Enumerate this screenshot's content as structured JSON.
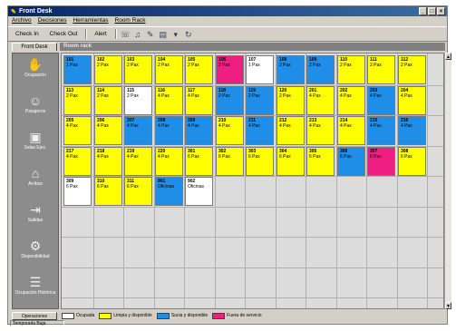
{
  "window": {
    "title": "Front Desk"
  },
  "menu": [
    "Archivo",
    "Decisiones",
    "Herramientas",
    "Room Rack"
  ],
  "toolbar": {
    "check_in": "Check In",
    "check_out": "Check Out",
    "alert": "Alert"
  },
  "tab": {
    "label": "Front Desk",
    "header": "Room rack"
  },
  "sidebar": [
    {
      "label": "Ocupación",
      "icon": "hand-key-icon"
    },
    {
      "label": "Pasajeros",
      "icon": "guests-icon"
    },
    {
      "label": "Salas Ejec.",
      "icon": "floppy-disk-icon"
    },
    {
      "label": "Arribos",
      "icon": "arrival-house-icon"
    },
    {
      "label": "Salidas",
      "icon": "departure-door-icon"
    },
    {
      "label": "Disponibilidad",
      "icon": "key-ring-icon"
    },
    {
      "label": "Ocupación Histórica",
      "icon": "history-report-icon"
    }
  ],
  "colors": {
    "yellow": "#ffff00",
    "blue": "#1e8ee8",
    "magenta": "#ee1f80",
    "white": "#ffffff"
  },
  "rooms": [
    [
      {
        "n": "101",
        "s": "1 Pax",
        "c": "blue"
      },
      {
        "n": "102",
        "s": "2 Pax",
        "c": "yellow"
      },
      {
        "n": "103",
        "s": "2 Pax",
        "c": "yellow"
      },
      {
        "n": "104",
        "s": "2 Pax",
        "c": "yellow"
      },
      {
        "n": "105",
        "s": "2 Pax",
        "c": "yellow"
      },
      {
        "n": "106",
        "s": "2 Pax",
        "c": "magenta"
      },
      {
        "n": "107",
        "s": "1 Pax",
        "c": "white"
      },
      {
        "n": "108",
        "s": "2 Pax",
        "c": "blue"
      },
      {
        "n": "109",
        "s": "2 Pax",
        "c": "blue"
      },
      {
        "n": "110",
        "s": "2 Pax",
        "c": "yellow"
      },
      {
        "n": "111",
        "s": "2 Pax",
        "c": "yellow"
      },
      {
        "n": "112",
        "s": "2 Pax",
        "c": "yellow"
      }
    ],
    [
      {
        "n": "113",
        "s": "2 Pax",
        "c": "yellow"
      },
      {
        "n": "114",
        "s": "2 Pax",
        "c": "yellow"
      },
      {
        "n": "115",
        "s": "2 Pax",
        "c": "white"
      },
      {
        "n": "116",
        "s": "4 Pax",
        "c": "yellow"
      },
      {
        "n": "117",
        "s": "4 Pax",
        "c": "yellow"
      },
      {
        "n": "118",
        "s": "2 Pax",
        "c": "blue"
      },
      {
        "n": "119",
        "s": "2 Pax",
        "c": "blue"
      },
      {
        "n": "120",
        "s": "2 Pax",
        "c": "yellow"
      },
      {
        "n": "201",
        "s": "4 Pax",
        "c": "yellow"
      },
      {
        "n": "202",
        "s": "4 Pax",
        "c": "yellow"
      },
      {
        "n": "203",
        "s": "4 Pax",
        "c": "blue"
      },
      {
        "n": "204",
        "s": "4 Pax",
        "c": "yellow"
      }
    ],
    [
      {
        "n": "205",
        "s": "4 Pax",
        "c": "yellow"
      },
      {
        "n": "206",
        "s": "4 Pax",
        "c": "yellow"
      },
      {
        "n": "207",
        "s": "4 Pax",
        "c": "blue"
      },
      {
        "n": "208",
        "s": "4 Pax",
        "c": "blue"
      },
      {
        "n": "209",
        "s": "4 Pax",
        "c": "blue"
      },
      {
        "n": "210",
        "s": "4 Pax",
        "c": "yellow"
      },
      {
        "n": "211",
        "s": "4 Pax",
        "c": "blue"
      },
      {
        "n": "212",
        "s": "4 Pax",
        "c": "yellow"
      },
      {
        "n": "213",
        "s": "4 Pax",
        "c": "yellow"
      },
      {
        "n": "214",
        "s": "4 Pax",
        "c": "yellow"
      },
      {
        "n": "215",
        "s": "4 Pax",
        "c": "blue"
      },
      {
        "n": "216",
        "s": "4 Pax",
        "c": "blue"
      }
    ],
    [
      {
        "n": "217",
        "s": "4 Pax",
        "c": "yellow"
      },
      {
        "n": "218",
        "s": "4 Pax",
        "c": "yellow"
      },
      {
        "n": "219",
        "s": "4 Pax",
        "c": "yellow"
      },
      {
        "n": "220",
        "s": "4 Pax",
        "c": "yellow"
      },
      {
        "n": "301",
        "s": "6 Pax",
        "c": "yellow"
      },
      {
        "n": "302",
        "s": "6 Pax",
        "c": "yellow"
      },
      {
        "n": "303",
        "s": "6 Pax",
        "c": "yellow"
      },
      {
        "n": "304",
        "s": "6 Pax",
        "c": "yellow"
      },
      {
        "n": "305",
        "s": "6 Pax",
        "c": "yellow"
      },
      {
        "n": "306",
        "s": "6 Pax",
        "c": "blue"
      },
      {
        "n": "307",
        "s": "6 Pax",
        "c": "magenta"
      },
      {
        "n": "308",
        "s": "6 Pax",
        "c": "yellow"
      }
    ],
    [
      {
        "n": "309",
        "s": "6 Pax",
        "c": "white"
      },
      {
        "n": "310",
        "s": "6 Pax",
        "c": "yellow"
      },
      {
        "n": "311",
        "s": "6 Pax",
        "c": "yellow"
      },
      {
        "n": "901",
        "s": "Oficinas",
        "c": "blue"
      },
      {
        "n": "902",
        "s": "Oficinas",
        "c": "white"
      }
    ]
  ],
  "legend": {
    "tab": "Operaciones",
    "items": [
      {
        "label": "Ocupada",
        "c": "white"
      },
      {
        "label": "Limpia y disponible",
        "c": "yellow"
      },
      {
        "label": "Sucia y disponible",
        "c": "blue"
      },
      {
        "label": "Fuera de servicio",
        "c": "magenta"
      }
    ]
  },
  "status": {
    "text": "Temporada Baja"
  }
}
